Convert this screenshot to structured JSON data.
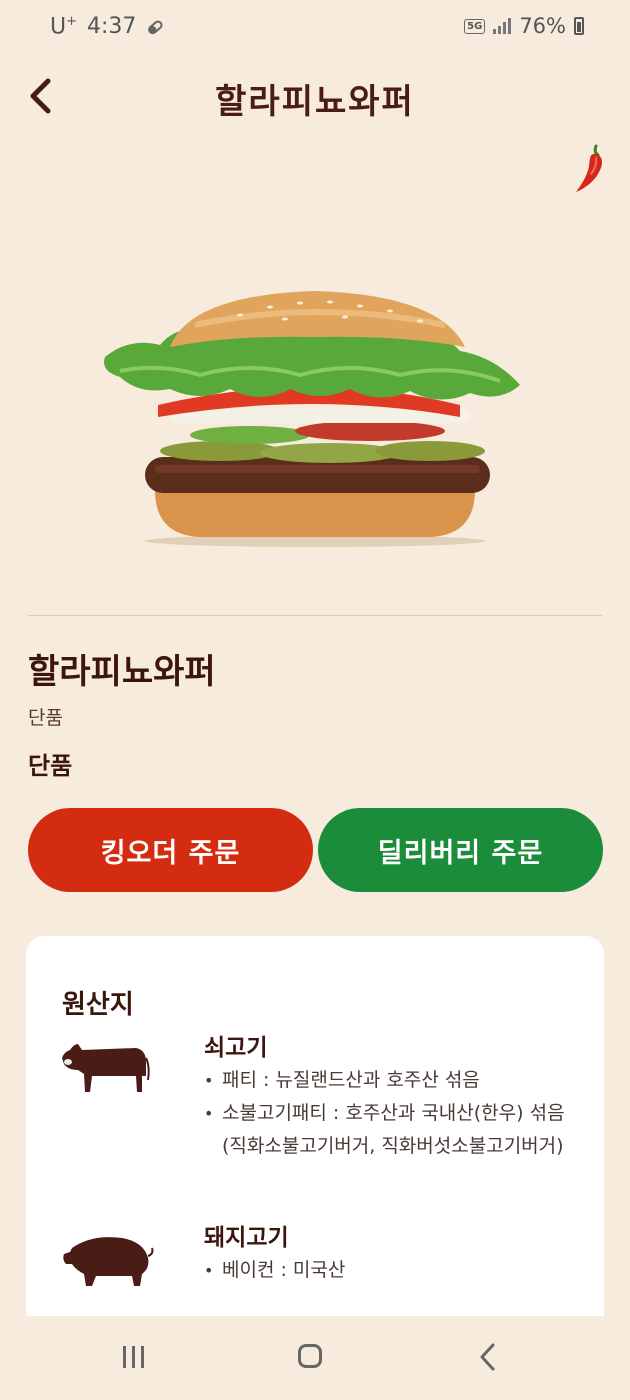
{
  "status_bar": {
    "carrier": "U",
    "carrier_sup": "+",
    "time": "4:37",
    "network": "5G",
    "battery": "76%"
  },
  "header": {
    "title": "할라피뇨와퍼"
  },
  "product": {
    "name": "할라피뇨와퍼",
    "type_label": "단품",
    "option": "단품",
    "spicy_icon": "chili-pepper-icon"
  },
  "buttons": {
    "king_order": "킹오더 주문",
    "delivery_order": "딜리버리 주문"
  },
  "origin": {
    "title": "원산지",
    "sections": [
      {
        "icon": "cow-icon",
        "name": "쇠고기",
        "items": [
          "패티 : 뉴질랜드산과 호주산 섞음",
          "소불고기패티 : 호주산과 국내산(한우) 섞음 (직화소불고기버거, 직화버섯소불고기버거)"
        ]
      },
      {
        "icon": "pig-icon",
        "name": "돼지고기",
        "items": [
          "베이컨 : 미국산"
        ]
      }
    ]
  },
  "colors": {
    "background": "#f6ebdd",
    "brand_brown": "#4a1c16",
    "king_red": "#d42c10",
    "delivery_green": "#1b8c3a"
  }
}
